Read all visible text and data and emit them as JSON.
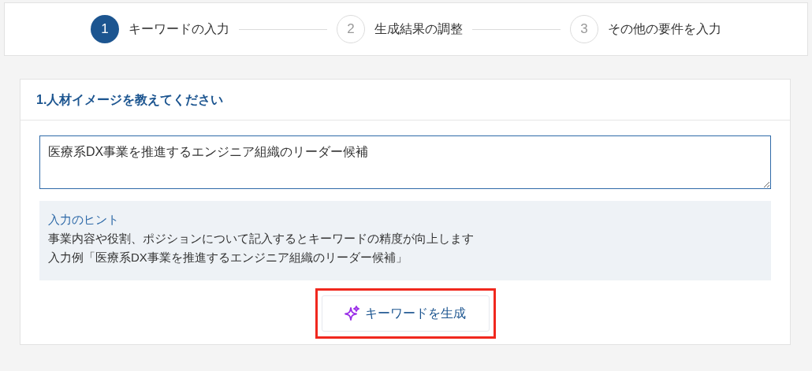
{
  "steps": [
    {
      "number": "1",
      "label": "キーワードの入力",
      "selected": true
    },
    {
      "number": "2",
      "label": "生成結果の調整",
      "selected": false
    },
    {
      "number": "3",
      "label": "その他の要件を入力",
      "selected": false
    }
  ],
  "section": {
    "title": "1.人材イメージを教えてください",
    "input": {
      "value": "医療系DX事業を推進するエンジニア組織のリーダー候補"
    },
    "hint": {
      "title": "入力のヒント",
      "lines": [
        "事業内容や役割、ポジションについて記入するとキーワードの精度が向上します",
        "入力例「医療系DX事業を推進するエンジニア組織のリーダー候補」"
      ]
    },
    "button": {
      "label": "キーワードを生成",
      "highlighted": true
    }
  }
}
